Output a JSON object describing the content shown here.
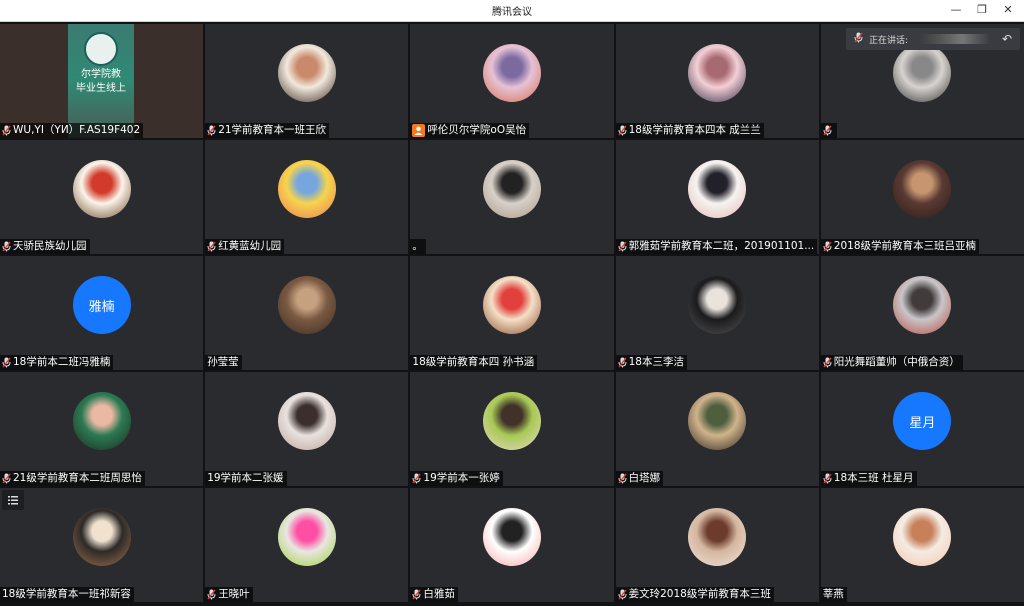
{
  "window": {
    "title": "腾讯会议",
    "minimize_icon": "minimize-icon",
    "restore_icon": "restore-icon",
    "close_icon": "close-icon"
  },
  "speaking": {
    "label": "正在讲话:"
  },
  "participants": [
    {
      "name": "WU,YI（YИ）F.AS19F402",
      "type": "video",
      "mic": true
    },
    {
      "name": "21学前教育本一班王欣",
      "type": "photo",
      "mic": true,
      "colors": [
        "#f2e9dd",
        "#c98a6c",
        "#3b2a22"
      ]
    },
    {
      "name": "呼伦贝尔学院oO吴怡",
      "type": "photo",
      "mic": false,
      "badge": "orange",
      "colors": [
        "#e6c2d6",
        "#7b6aa0",
        "#d66e4c"
      ]
    },
    {
      "name": "18级学前教育本四本  成兰兰",
      "type": "photo",
      "mic": true,
      "colors": [
        "#f4cfd6",
        "#a86a72",
        "#2b2b40"
      ]
    },
    {
      "name": "",
      "type": "photo",
      "mic": true,
      "colors": [
        "#d7d3cf",
        "#888",
        "#333"
      ]
    },
    {
      "name": "天骄民族幼儿园",
      "type": "photo",
      "mic": true,
      "colors": [
        "#fbf4ea",
        "#d23b2b",
        "#6d4a2c"
      ]
    },
    {
      "name": "红黄蓝幼儿园",
      "type": "photo",
      "mic": true,
      "colors": [
        "#f7d44c",
        "#75a7de",
        "#e97b5a"
      ]
    },
    {
      "name": "。",
      "type": "photo",
      "mic": false,
      "colors": [
        "#d8d1c8",
        "#222",
        "#aa9988"
      ]
    },
    {
      "name": "郭雅茹学前教育本二班，201901101...",
      "type": "photo",
      "mic": true,
      "colors": [
        "#f6f3f1",
        "#22202a",
        "#e6b9b3"
      ]
    },
    {
      "name": "2018级学前教育本三班吕亚楠",
      "type": "photo",
      "mic": true,
      "colors": [
        "#5a3a33",
        "#c79670",
        "#2b1b18"
      ]
    },
    {
      "name": "18学前本二班冯雅楠",
      "type": "letter",
      "letter": "雅楠",
      "mic": true
    },
    {
      "name": "孙莹莹",
      "type": "photo",
      "mic": false,
      "colors": [
        "#7a5a43",
        "#c6a17f",
        "#3b2c23"
      ]
    },
    {
      "name": "18级学前教育本四  孙书涵",
      "type": "photo",
      "mic": false,
      "colors": [
        "#f4e0c7",
        "#e2403c",
        "#8a4a2a"
      ]
    },
    {
      "name": "18本三李洁",
      "type": "photo",
      "mic": true,
      "colors": [
        "#1b1b1e",
        "#e9e3dc",
        "#555"
      ]
    },
    {
      "name": "阳光舞蹈董帅（中俄合资）",
      "type": "photo",
      "mic": true,
      "colors": [
        "#c9c6c9",
        "#413b3c",
        "#b7493f"
      ]
    },
    {
      "name": "21级学前教育本二班周思怡",
      "type": "photo",
      "mic": true,
      "colors": [
        "#2c7a52",
        "#eab8a3",
        "#1c2b22"
      ]
    },
    {
      "name": "19学前本二张媛",
      "type": "photo",
      "mic": false,
      "colors": [
        "#e9e2df",
        "#3a2f2c",
        "#bba199"
      ]
    },
    {
      "name": "19学前本一张婷",
      "type": "photo",
      "mic": true,
      "colors": [
        "#a8c954",
        "#403129",
        "#e8d8c8"
      ]
    },
    {
      "name": "白塔娜",
      "type": "photo",
      "mic": true,
      "colors": [
        "#d0b38b",
        "#4f5f3e",
        "#2c241f"
      ]
    },
    {
      "name": "18本三班  杜星月",
      "type": "letter",
      "letter": "星月",
      "mic": true
    },
    {
      "name": "18级学前教育本一班祁新容",
      "type": "photo",
      "mic": false,
      "colors": [
        "#2d2a28",
        "#f0e2cf",
        "#a2724e"
      ]
    },
    {
      "name": "王晓叶",
      "type": "photo",
      "mic": true,
      "colors": [
        "#e9e6e2",
        "#ff4fa5",
        "#9ad23a"
      ]
    },
    {
      "name": "白雅茹",
      "type": "photo",
      "mic": true,
      "colors": [
        "#ffffff",
        "#222222",
        "#f2a6a2"
      ]
    },
    {
      "name": "姜文玲2018级学前教育本三班",
      "type": "photo",
      "mic": true,
      "colors": [
        "#d5b7a0",
        "#6c3b2c",
        "#efe3db"
      ]
    },
    {
      "name": "莘燕",
      "type": "photo",
      "mic": false,
      "colors": [
        "#f4ece4",
        "#c7805a",
        "#f7c3a5"
      ]
    }
  ],
  "video_tile": {
    "sign_line1": "尔学院教",
    "sign_line2": "毕业生线上"
  },
  "colors": {
    "letter_avatar": "#1677ff",
    "tile_bg": "#2a2b2f"
  }
}
